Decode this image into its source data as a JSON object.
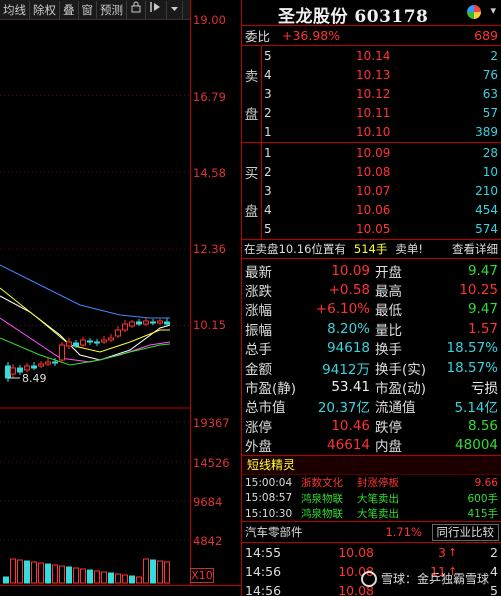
{
  "toolbar": {
    "items": [
      "均线",
      "除权",
      "叠",
      "窗",
      "预测"
    ],
    "icon_lock": "🔒",
    "icon_arrow": "⊢▸",
    "icon_menu": "▾"
  },
  "price_axis": [
    "19.00",
    "16.79",
    "14.58",
    "12.36",
    "10.15"
  ],
  "volume_axis": [
    "19367",
    "14526",
    "9684",
    "4842"
  ],
  "low_marker": "8.49",
  "scale_button": "X10",
  "chart_data": {
    "type": "candlestick",
    "title": "",
    "ylim": [
      8.0,
      19.0
    ],
    "y_ticks": [
      19.0,
      16.79,
      14.58,
      12.36,
      10.15
    ],
    "volume_ticks": [
      19367,
      14526,
      9684,
      4842
    ],
    "low_annotation": 8.49
  },
  "header": {
    "title": "圣龙股份 603178"
  },
  "weibi": {
    "label": "委比",
    "percent": "+36.98%",
    "value": "689"
  },
  "sell_side_label": [
    "卖",
    "盘"
  ],
  "buy_side_label": [
    "买",
    "盘"
  ],
  "sell": [
    {
      "level": "5",
      "price": "10.14",
      "volume": "2"
    },
    {
      "level": "4",
      "price": "10.13",
      "volume": "76"
    },
    {
      "level": "3",
      "price": "10.12",
      "volume": "63"
    },
    {
      "level": "2",
      "price": "10.11",
      "volume": "57"
    },
    {
      "level": "1",
      "price": "10.10",
      "volume": "389"
    }
  ],
  "buy": [
    {
      "level": "1",
      "price": "10.09",
      "volume": "28"
    },
    {
      "level": "2",
      "price": "10.08",
      "volume": "10"
    },
    {
      "level": "3",
      "price": "10.07",
      "volume": "210"
    },
    {
      "level": "4",
      "price": "10.06",
      "volume": "454"
    },
    {
      "level": "5",
      "price": "10.05",
      "volume": "574"
    }
  ],
  "trade_info": {
    "position": "在卖盘10.16位置有",
    "amount": "514手",
    "single": "卖单!",
    "detail": "查看详细"
  },
  "quotes": [
    {
      "l": "最新",
      "v": "10.09",
      "vc": "red",
      "l2": "开盘",
      "v2": "9.47",
      "v2c": "green"
    },
    {
      "l": "涨跌",
      "v": "+0.58",
      "vc": "red",
      "l2": "最高",
      "v2": "10.25",
      "v2c": "red"
    },
    {
      "l": "涨幅",
      "v": "+6.10%",
      "vc": "red",
      "l2": "最低",
      "v2": "9.47",
      "v2c": "green"
    },
    {
      "l": "振幅",
      "v": "8.20%",
      "vc": "cyan",
      "l2": "量比",
      "v2": "1.57",
      "v2c": "red"
    },
    {
      "l": "总手",
      "v": "94618",
      "vc": "cyan",
      "l2": "换手",
      "v2": "18.57%",
      "v2c": "cyan"
    },
    {
      "l": "金额",
      "v": "9412万",
      "vc": "cyan",
      "l2": "换手(实)",
      "v2": "18.57%",
      "v2c": "cyan"
    },
    {
      "l": "市盈(静)",
      "v": "53.41",
      "vc": "white",
      "l2": "市盈(动)",
      "v2": "亏损",
      "v2c": "white"
    },
    {
      "l": "总市值",
      "v": "20.37亿",
      "vc": "cyan",
      "l2": "流通值",
      "v2": "5.14亿",
      "v2c": "cyan"
    },
    {
      "l": "涨停",
      "v": "10.46",
      "vc": "red",
      "l2": "跌停",
      "v2": "8.56",
      "v2c": "green"
    },
    {
      "l": "外盘",
      "v": "46614",
      "vc": "red",
      "l2": "内盘",
      "v2": "48004",
      "v2c": "green"
    }
  ],
  "elf": {
    "title": "短线精灵",
    "rows": [
      {
        "time": "15:00:04",
        "name": "浙数文化",
        "event": "封涨停板",
        "value": "9.66",
        "color": "red"
      },
      {
        "time": "15:08:57",
        "name": "鸿泉物联",
        "event": "大笔卖出",
        "value": "600手",
        "color": "green"
      },
      {
        "time": "15:10:30",
        "name": "鸿泉物联",
        "event": "大笔卖出",
        "value": "415手",
        "color": "green"
      }
    ]
  },
  "sector": {
    "name": "汽车零部件",
    "percent": "1.71%",
    "button": "同行业比较"
  },
  "ticks": [
    {
      "time": "14:55",
      "price": "10.08",
      "volume": "3",
      "arrow": "↑",
      "extra": "2"
    },
    {
      "time": "14:56",
      "price": "10.08",
      "volume": "11",
      "arrow": "↑",
      "extra": "4"
    },
    {
      "time": "14:56",
      "price": "10.08",
      "volume": "",
      "arrow": "",
      "extra": "5"
    }
  ],
  "watermark": "雪球：金乒独霸雪球"
}
